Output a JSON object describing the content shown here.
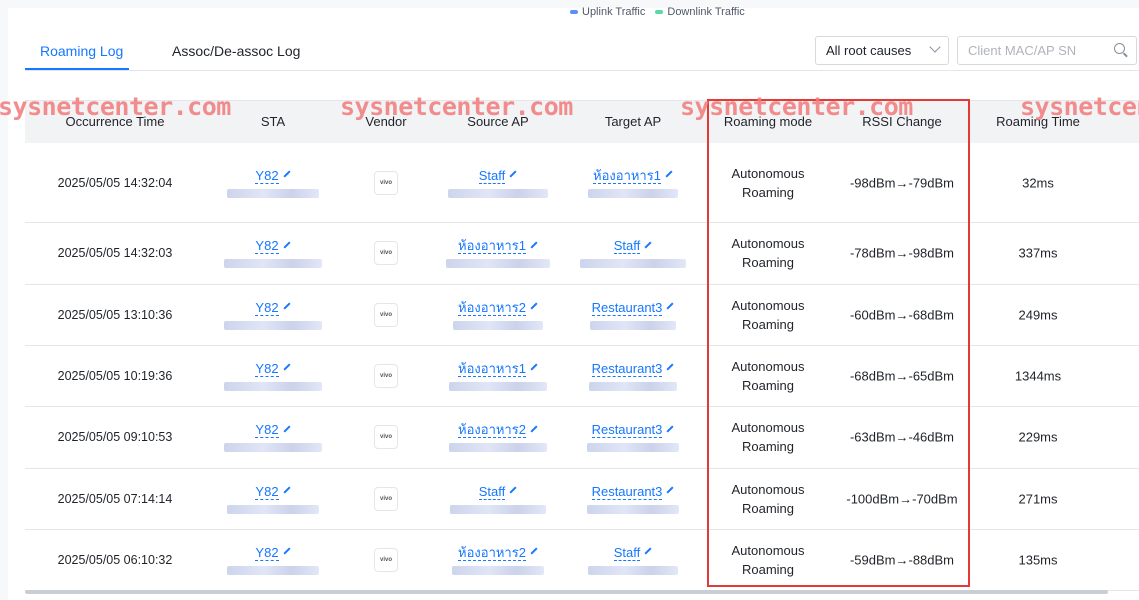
{
  "legend": [
    {
      "label": "Uplink Traffic",
      "color": "#5b8ff9"
    },
    {
      "label": "Downlink Traffic",
      "color": "#5ad8a6"
    }
  ],
  "tabs": [
    {
      "label": "Roaming Log",
      "active": true
    },
    {
      "label": "Assoc/De-assoc Log",
      "active": false
    }
  ],
  "filter": {
    "selected": "All root causes"
  },
  "search": {
    "placeholder": "Client MAC/AP SN"
  },
  "watermark": "sysnetcenter.com",
  "columns": [
    "Occurrence Time",
    "STA",
    "Vendor",
    "Source AP",
    "Target AP",
    "Roaming mode",
    "RSSI Change",
    "Roaming Time"
  ],
  "rows": [
    {
      "time": "2025/05/05 14:32:04",
      "sta": "Y82",
      "vendor": "vivo",
      "source": "Staff",
      "target": "ห้องอาหาร1",
      "mode": "Autonomous Roaming",
      "rssi": "-98dBm→-79dBm",
      "roam_time": "32ms"
    },
    {
      "time": "2025/05/05 14:32:03",
      "sta": "Y82",
      "vendor": "vivo",
      "source": "ห้องอาหาร1",
      "target": "Staff",
      "mode": "Autonomous Roaming",
      "rssi": "-78dBm→-98dBm",
      "roam_time": "337ms"
    },
    {
      "time": "2025/05/05 13:10:36",
      "sta": "Y82",
      "vendor": "vivo",
      "source": "ห้องอาหาร2",
      "target": "Restaurant3",
      "mode": "Autonomous Roaming",
      "rssi": "-60dBm→-68dBm",
      "roam_time": "249ms"
    },
    {
      "time": "2025/05/05 10:19:36",
      "sta": "Y82",
      "vendor": "vivo",
      "source": "ห้องอาหาร1",
      "target": "Restaurant3",
      "mode": "Autonomous Roaming",
      "rssi": "-68dBm→-65dBm",
      "roam_time": "1344ms"
    },
    {
      "time": "2025/05/05 09:10:53",
      "sta": "Y82",
      "vendor": "vivo",
      "source": "ห้องอาหาร2",
      "target": "Restaurant3",
      "mode": "Autonomous Roaming",
      "rssi": "-63dBm→-46dBm",
      "roam_time": "229ms"
    },
    {
      "time": "2025/05/05 07:14:14",
      "sta": "Y82",
      "vendor": "vivo",
      "source": "Staff",
      "target": "Restaurant3",
      "mode": "Autonomous Roaming",
      "rssi": "-100dBm→-70dBm",
      "roam_time": "271ms"
    },
    {
      "time": "2025/05/05 06:10:32",
      "sta": "Y82",
      "vendor": "vivo",
      "source": "ห้องอาหาร2",
      "target": "Staff",
      "mode": "Autonomous Roaming",
      "rssi": "-59dBm→-88dBm",
      "roam_time": "135ms"
    }
  ]
}
